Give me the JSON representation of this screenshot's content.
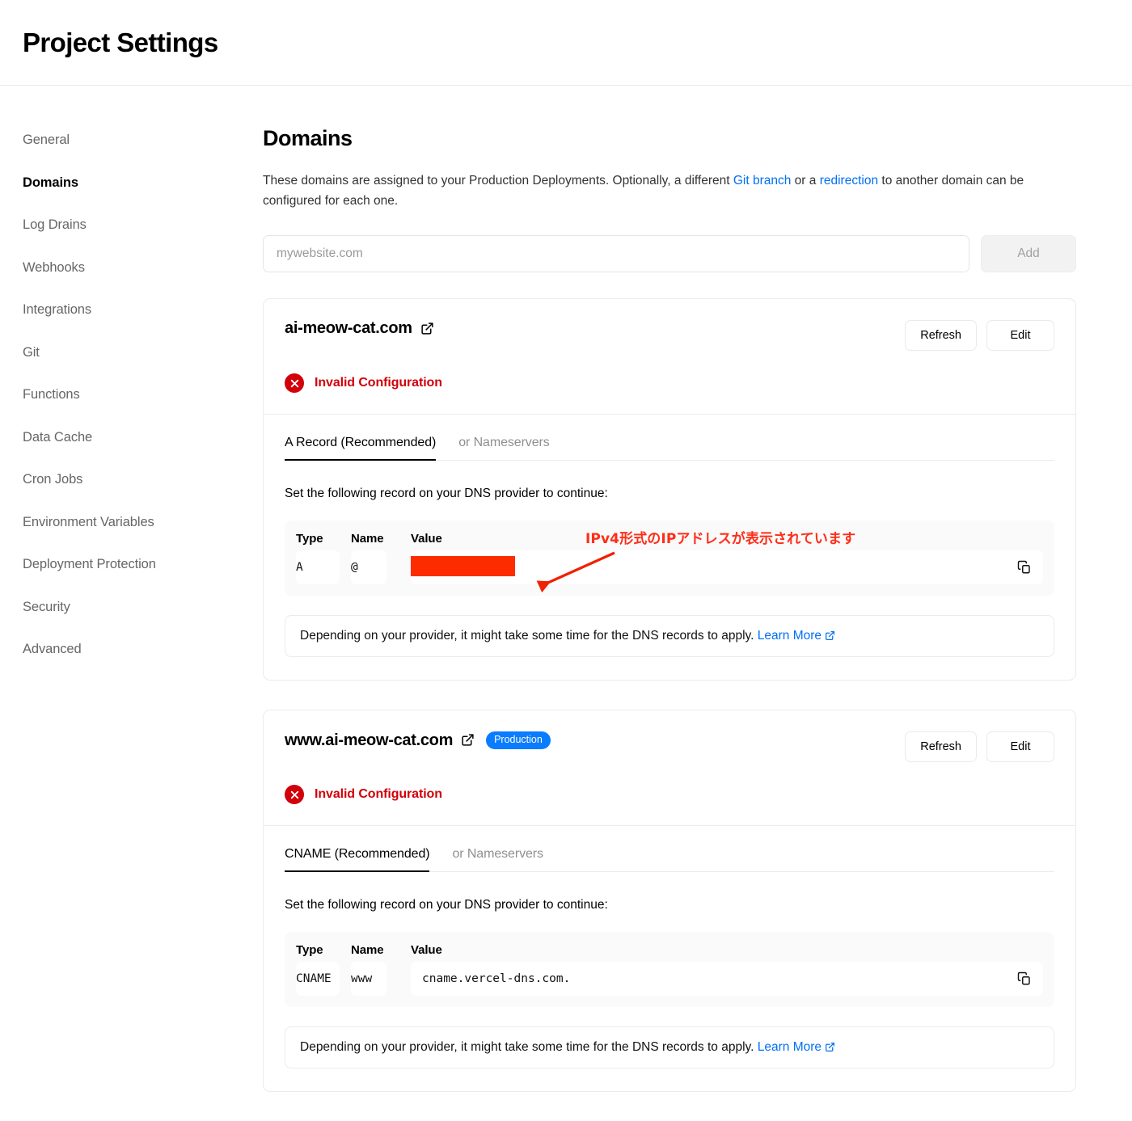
{
  "header": {
    "title": "Project Settings"
  },
  "sidebar": {
    "items": [
      {
        "label": "General",
        "active": false
      },
      {
        "label": "Domains",
        "active": true
      },
      {
        "label": "Log Drains",
        "active": false
      },
      {
        "label": "Webhooks",
        "active": false
      },
      {
        "label": "Integrations",
        "active": false
      },
      {
        "label": "Git",
        "active": false
      },
      {
        "label": "Functions",
        "active": false
      },
      {
        "label": "Data Cache",
        "active": false
      },
      {
        "label": "Cron Jobs",
        "active": false
      },
      {
        "label": "Environment Variables",
        "active": false
      },
      {
        "label": "Deployment Protection",
        "active": false
      },
      {
        "label": "Security",
        "active": false
      },
      {
        "label": "Advanced",
        "active": false
      }
    ]
  },
  "main": {
    "section_title": "Domains",
    "description": {
      "part1": "These domains are assigned to your Production Deployments. Optionally, a different ",
      "link1": "Git branch",
      "part2": " or a ",
      "link2": "redirection",
      "part3": " to another domain can be configured for each one."
    },
    "add_form": {
      "input_placeholder": "mywebsite.com",
      "input_value": "",
      "add_label": "Add"
    },
    "cards": [
      {
        "domain": "ai-meow-cat.com",
        "external_link_icon": "external-link-icon",
        "badge": null,
        "refresh_label": "Refresh",
        "edit_label": "Edit",
        "status_icon": "error-circle-x-icon",
        "status_text": "Invalid Configuration",
        "tabs": [
          {
            "label": "A Record (Recommended)",
            "active": true
          },
          {
            "label": "or Nameservers",
            "active": false
          }
        ],
        "record_hint": "Set the following record on your DNS provider to continue:",
        "table": {
          "columns": [
            "Type",
            "Name",
            "Value"
          ],
          "row": {
            "type": "A",
            "name": "@",
            "value": "",
            "value_redacted": true
          },
          "copy_icon": "copy-icon"
        },
        "note": {
          "text": "Depending on your provider, it might take some time for the DNS records to apply. ",
          "link": "Learn More",
          "link_icon": "external-link-icon"
        }
      },
      {
        "domain": "www.ai-meow-cat.com",
        "external_link_icon": "external-link-icon",
        "badge": "Production",
        "refresh_label": "Refresh",
        "edit_label": "Edit",
        "status_icon": "error-circle-x-icon",
        "status_text": "Invalid Configuration",
        "tabs": [
          {
            "label": "CNAME (Recommended)",
            "active": true
          },
          {
            "label": "or Nameservers",
            "active": false
          }
        ],
        "record_hint": "Set the following record on your DNS provider to continue:",
        "table": {
          "columns": [
            "Type",
            "Name",
            "Value"
          ],
          "row": {
            "type": "CNAME",
            "name": "www",
            "value": "cname.vercel-dns.com.",
            "value_redacted": false
          },
          "copy_icon": "copy-icon"
        },
        "note": {
          "text": "Depending on your provider, it might take some time for the DNS records to apply. ",
          "link": "Learn More",
          "link_icon": "external-link-icon"
        }
      }
    ]
  },
  "annotation": {
    "text": "IPv4形式のIPアドレスが表示されています",
    "color": "#ff2d1a",
    "arrow_icon": "arrow-pointing-down-left-icon"
  },
  "colors": {
    "accent_blue": "#0070f3",
    "badge_blue": "#0a7cff",
    "error_red": "#d1000b",
    "redaction_red": "#fd2c00",
    "border": "#ebebeb",
    "muted_text": "#666666"
  }
}
